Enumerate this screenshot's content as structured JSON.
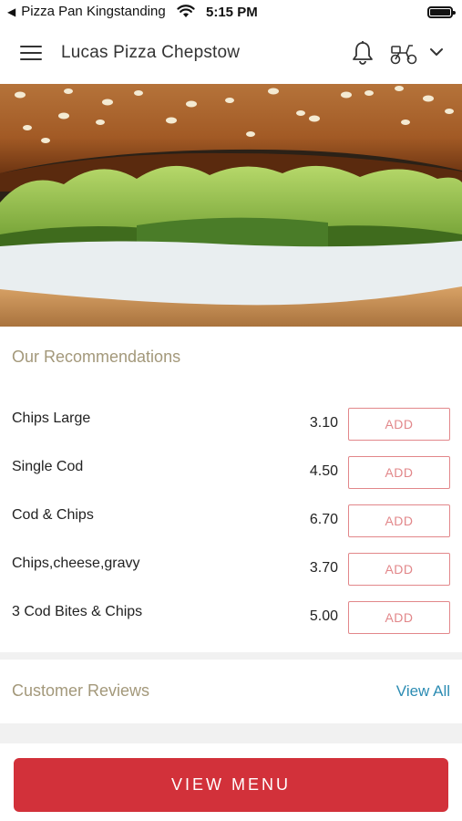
{
  "status_bar": {
    "back_label": "Pizza Pan Kingstanding",
    "time": "5:15 PM"
  },
  "header": {
    "title": "Lucas Pizza Chepstow",
    "icons": [
      "menu-icon",
      "bell-icon",
      "scooter-icon",
      "chevron-down-icon"
    ]
  },
  "hero": {
    "icon": "burger-photo"
  },
  "recommendations": {
    "title": "Our Recommendations",
    "items": [
      {
        "name": "Chips Large",
        "price": "3.10",
        "add_label": "ADD"
      },
      {
        "name": "Single Cod",
        "price": "4.50",
        "add_label": "ADD"
      },
      {
        "name": "Cod & Chips",
        "price": "6.70",
        "add_label": "ADD"
      },
      {
        "name": "Chips,cheese,gravy",
        "price": "3.70",
        "add_label": "ADD"
      },
      {
        "name": "3 Cod Bites & Chips",
        "price": "5.00",
        "add_label": "ADD"
      }
    ]
  },
  "reviews": {
    "title": "Customer Reviews",
    "view_all": "View All"
  },
  "footer": {
    "view_menu": "VIEW MENU"
  },
  "colors": {
    "accent_red": "#d2313a",
    "add_border": "#e2878a",
    "section_title": "#a3987a",
    "link_blue": "#2c8cb3"
  }
}
